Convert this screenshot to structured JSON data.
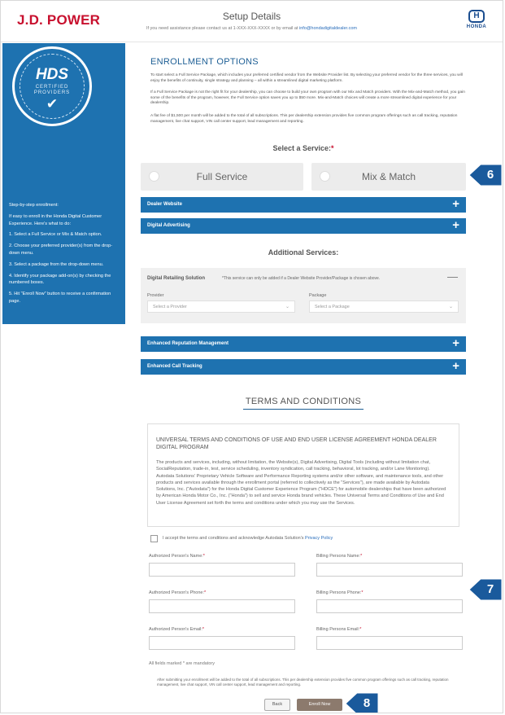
{
  "header": {
    "brand": "J.D. POWER",
    "title": "Setup Details",
    "subtitle_prefix": "If you need assistance please contact us at 1-XXX-XXX-XXXX or by email at ",
    "subtitle_link": "info@hondadigitaldealer.com",
    "honda_logo_text": "HONDA",
    "honda_logo_glyph": "H"
  },
  "sidebar": {
    "badge_title": "HDS",
    "badge_line1": "CERTIFIED",
    "badge_line2": "PROVIDERS",
    "badge_check": "✔",
    "steps": [
      "Step-by-step enrollment:",
      "If easy to enroll in the Honda Digital Customer Experience. Here's what to do:",
      "1. Select a Full Service or Mix & Match option.",
      "2. Choose your preferred provider(s) from the drop-down menu.",
      "3. Select a package from the drop-down menu.",
      "4. Identify your package add-on(s) by checking the numbered boxes.",
      "5. Hit \"Enroll Now\" button to receive a confirmation page."
    ]
  },
  "enrollment": {
    "title": "ENROLLMENT OPTIONS",
    "paragraphs": [
      "To start select a Full Service Package, which includes your preferred certified vendor from the Website Provider list. By selecting your preferred vendor for the three services, you will enjoy the benefits of continuity, single strategy and planning – all within a streamlined digital marketing platform.",
      "If a Full Service Package is not the right fit for your dealership, you can choose to build your own program with our Mix and Match providers. With the Mix-and-Match method, you gain some of the benefits of the program, however, the Full Service option saves you up to $50 more. Mix-and-Match choices will create a more streamlined digital experience for your dealership.",
      "A flat fee of $1,500 per month will be added to the total of all subscriptions. This per dealership extension provides five common program offerings such as call tracking, reputation management, live chat support, VIN call center support, lead management and reporting."
    ]
  },
  "service": {
    "label": "Select a Service:",
    "required_mark": "*",
    "options": [
      {
        "label": "Full Service"
      },
      {
        "label": "Mix & Match"
      }
    ]
  },
  "sections": {
    "dealer_website": "Dealer Website",
    "digital_advertising": "Digital Advertising",
    "expand_glyph": "+",
    "additional_label": "Additional Services:",
    "digital_retailing": {
      "title": "Digital Retailing Solution",
      "note": "*This service can only be added if a Dealer Website Provider/Package is chosen above.",
      "collapse_glyph": "—",
      "provider_label": "Provider",
      "provider_value": "Select a Provider",
      "package_label": "Package",
      "package_value": "Select a Package",
      "chevron": "⌄"
    },
    "reputation": "Enhanced Reputation Management",
    "call_tracking": "Enhanced Call Tracking"
  },
  "terms": {
    "title": "TERMS AND CONDITIONS",
    "heading": "UNIVERSAL TERMS AND CONDITIONS OF USE AND END USER LICENSE AGREEMENT HONDA DEALER DIGITAL PROGRAM",
    "body": "The products and services, including, without limitation, the Website(s), Digital Advertising, Digital Tools (including without limitation chat, SocialReputation, trade-in, test, service scheduling, inventory syndication, call tracking, behavioral, lot tracking, and/or Lane Monitoring). Autodata Solutions' Proprietary Vehicle Software and Performance Reporting systems and/or other software, and maintenance tools, and other products and services available through the enrollment portal (referred to collectively as the \"Services\"), are made available by Autodata Solutions, Inc. (\"Autodata\") for the Honda Digital Customer Experience Program (\"HDCE\") for automobile dealerships that have been authorized by American Honda Motor Co., Inc. (\"Honda\") to sell and service Honda brand vehicles. These Universal Terms and Conditions of Use and End User License Agreement set forth the terms and conditions under which you may use the Services.",
    "agree_prefix": "I accept the terms and conditions and acknowledge Autodata Solution's ",
    "agree_link": "Privacy Policy",
    "agreed": false
  },
  "form": {
    "auth_name_label": "Authorized Person's Name:",
    "billing_name_label": "Billing Persons Name:",
    "auth_phone_label": "Authorized Person's Phone:",
    "billing_phone_label": "Billing Persons Phone:",
    "auth_email_label": "Authorized Person's Email:",
    "billing_email_label": "Billing Persons Email:",
    "req": "*",
    "auth_name_value": "",
    "billing_name_value": "",
    "auth_phone_value": "",
    "billing_phone_value": "",
    "auth_email_value": "",
    "billing_email_value": "",
    "mandatory_note": "All fields marked * are mandatory",
    "footnote": "After submitting your enrollment will be added to the total of all subscriptions. This per dealership extension provides five common program offerings such as call tracking, reputation management, live chat support, VIN call center support, lead management and reporting."
  },
  "actions": {
    "back": "Back",
    "enroll": "Enroll Now"
  },
  "callouts": [
    "6",
    "7",
    "8"
  ],
  "colors": {
    "brand_red": "#c8102e",
    "accent_blue": "#1e72b0",
    "callout_blue": "#1a5a9c",
    "enroll_brown": "#8c7a6d"
  }
}
